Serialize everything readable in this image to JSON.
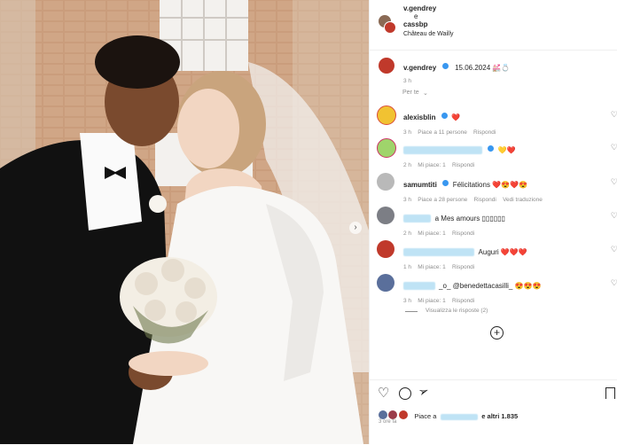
{
  "header": {
    "user1": "v.gendrey",
    "and": "e",
    "user2": "cassbp",
    "location": "Château de Wailly"
  },
  "caption": {
    "user": "v.gendrey",
    "text": "15.06.2024 💒💍",
    "time": "3 h"
  },
  "for_you": "Per te",
  "comments": [
    {
      "user": "alexisblin",
      "verified": true,
      "text": "❤️",
      "time": "3 h",
      "likes": "Piace a 11 persone",
      "reply": "Rispondi",
      "translate": ""
    },
    {
      "user": "",
      "verified": true,
      "text": "💛❤️",
      "time": "2 h",
      "likes": "Mi piace: 1",
      "reply": "Rispondi",
      "translate": ""
    },
    {
      "user": "samumtiti",
      "verified": true,
      "text": "Félicitations ❤️😍❤️😍",
      "time": "3 h",
      "likes": "Piace a 28 persone",
      "reply": "Rispondi",
      "translate": "Vedi traduzione"
    },
    {
      "user": "",
      "verified": false,
      "text": "a Mes amours ▯▯▯▯▯▯",
      "time": "2 h",
      "likes": "Mi piace: 1",
      "reply": "Rispondi",
      "translate": ""
    },
    {
      "user": "",
      "verified": false,
      "text": "Auguri ❤️❤️❤️",
      "time": "1 h",
      "likes": "Mi piace: 1",
      "reply": "Rispondi",
      "translate": ""
    },
    {
      "user": "",
      "verified": false,
      "text": "_o_ @benedettacasilli_ 😍😍😍",
      "time": "3 h",
      "likes": "Mi piace: 1",
      "reply": "Rispondi",
      "translate": ""
    }
  ],
  "view_replies": "Visualizza le risposte (2)",
  "likes_line": {
    "prefix": "Piace a",
    "suffix": "e altri 1.835"
  },
  "post_time": "3 ore fa"
}
